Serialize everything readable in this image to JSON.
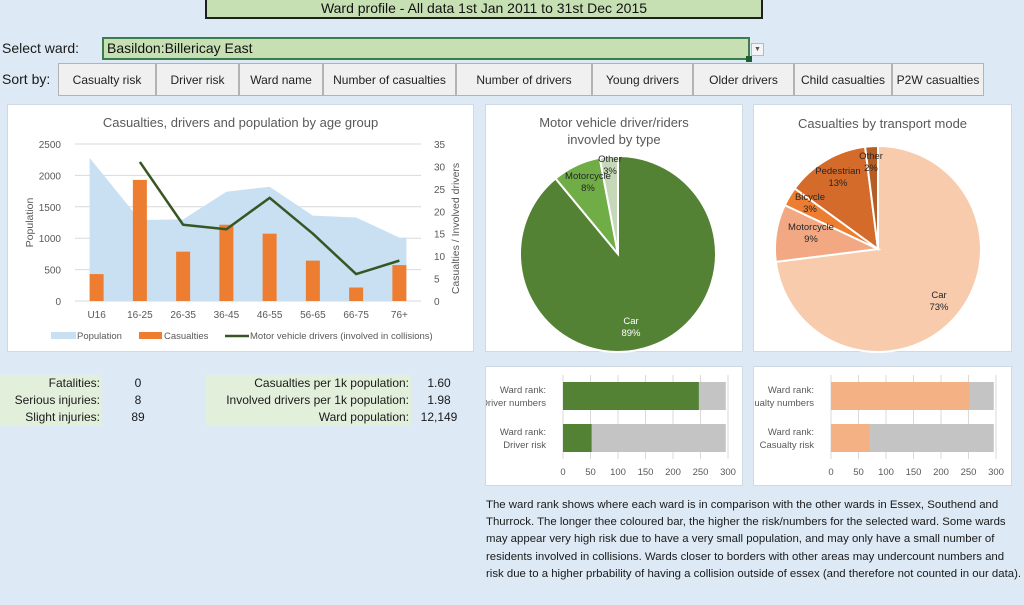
{
  "header": {
    "title": "Ward profile - All data 1st Jan 2011 to 31st Dec 2015"
  },
  "ward_select": {
    "label": "Select ward:",
    "value": "Basildon:Billericay East",
    "dropdown_icon": "chevron-down-icon"
  },
  "sort": {
    "label": "Sort by:",
    "buttons": [
      {
        "label": "Casualty risk"
      },
      {
        "label": "Driver risk"
      },
      {
        "label": "Ward name"
      },
      {
        "label": "Number of casualties"
      },
      {
        "label": "Number of drivers"
      },
      {
        "label": "Young drivers"
      },
      {
        "label": "Older drivers"
      },
      {
        "label": "Child casualties"
      },
      {
        "label": "P2W casualties"
      }
    ]
  },
  "stats_left": [
    {
      "label": "Fatalities:",
      "value": "0"
    },
    {
      "label": "Serious injuries:",
      "value": "8"
    },
    {
      "label": "Slight injuries:",
      "value": "89"
    }
  ],
  "stats_right": [
    {
      "label": "Casualties per 1k population:",
      "value": "1.60"
    },
    {
      "label": "Involved drivers per 1k population:",
      "value": "1.98"
    },
    {
      "label": "Ward population:",
      "value": "12,149"
    }
  ],
  "note": "The ward rank shows where each ward is in comparison with the other wards in Essex, Southend and Thurrock. The longer thee coloured bar, the higher the risk/numbers for the selected ward. Some wards may appear very high risk due to have a very small population, and may only have a small number of residents involved in collisions. Wards closer to borders with other areas may undercount numbers and risk due to a higher prbability of having a collision outside of essex (and therefore not counted in our data).",
  "colors": {
    "population": "#c9dff2",
    "casualties": "#ed7d31",
    "drivers": "#375623",
    "rank_grey": "#c4c4c4",
    "driver_green": "#548235",
    "casualty_peach": "#f4b183"
  },
  "chart_data": [
    {
      "type": "bar",
      "title": "Casualties, drivers and population by age group",
      "categories": [
        "U16",
        "16-25",
        "26-35",
        "36-45",
        "46-55",
        "56-65",
        "66-75",
        "76+"
      ],
      "ylabel": "Population",
      "y2label": "Casualties / Involved drivers",
      "ylim": [
        0,
        2500
      ],
      "yticks": [
        "0",
        "500",
        "1000",
        "1500",
        "2000",
        "2500"
      ],
      "y2lim": [
        0,
        35
      ],
      "y2ticks": [
        "0",
        "5",
        "10",
        "15",
        "20",
        "25",
        "30",
        "35"
      ],
      "grid": true,
      "legend": "bottom",
      "series": [
        {
          "name": "Population",
          "kind": "area",
          "axis": "left",
          "values": [
            2280,
            1290,
            1300,
            1740,
            1820,
            1360,
            1330,
            1010
          ]
        },
        {
          "name": "Casualties",
          "kind": "bar",
          "axis": "right",
          "values": [
            6,
            27,
            11,
            17,
            15,
            9,
            3,
            8
          ]
        },
        {
          "name": "Motor vehicle drivers (involved in collisions)",
          "kind": "line",
          "axis": "right",
          "values": [
            null,
            31,
            17,
            16,
            23,
            15,
            6,
            9
          ]
        }
      ]
    },
    {
      "type": "pie",
      "title": "Motor vehicle driver/riders invovled by type",
      "title_lines": [
        "Motor vehicle driver/riders",
        "invovled by type"
      ],
      "slices": [
        {
          "label": "Car",
          "value": 89,
          "display": "89%",
          "color": "#548235"
        },
        {
          "label": "Motorcycle",
          "value": 8,
          "display": "8%",
          "color": "#70ad47"
        },
        {
          "label": "Other",
          "value": 3,
          "display": "3%",
          "color": "#c5d9b8"
        }
      ]
    },
    {
      "type": "pie",
      "title": "Casualties by transport mode",
      "slices": [
        {
          "label": "Car",
          "value": 73,
          "display": "73%",
          "color": "#f8cbad"
        },
        {
          "label": "Motorcycle",
          "value": 9,
          "display": "9%",
          "color": "#f2a883"
        },
        {
          "label": "Bicycle",
          "value": 3,
          "display": "3%",
          "color": "#ed7d31"
        },
        {
          "label": "Pedestrian",
          "value": 13,
          "display": "13%",
          "color": "#d46b2b"
        },
        {
          "label": "Other",
          "value": 2,
          "display": "2%",
          "color": "#b55d24"
        }
      ]
    },
    {
      "type": "bar",
      "orientation": "horizontal",
      "stacked": true,
      "categories": [
        "Ward rank:|Driver numbers",
        "Ward rank:|Driver risk"
      ],
      "xlim": [
        0,
        300
      ],
      "xticks": [
        "0",
        "50",
        "100",
        "150",
        "200",
        "250",
        "300"
      ],
      "total": 296,
      "series": [
        {
          "name": "Rank",
          "values": [
            247,
            52
          ]
        }
      ]
    },
    {
      "type": "bar",
      "orientation": "horizontal",
      "stacked": true,
      "categories": [
        "Ward rank:|Casualty numbers",
        "Ward rank:|Casualty risk"
      ],
      "xlim": [
        0,
        300
      ],
      "xticks": [
        "0",
        "50",
        "100",
        "150",
        "200",
        "250",
        "300"
      ],
      "total": 296,
      "series": [
        {
          "name": "Rank",
          "values": [
            252,
            70
          ]
        }
      ]
    }
  ]
}
